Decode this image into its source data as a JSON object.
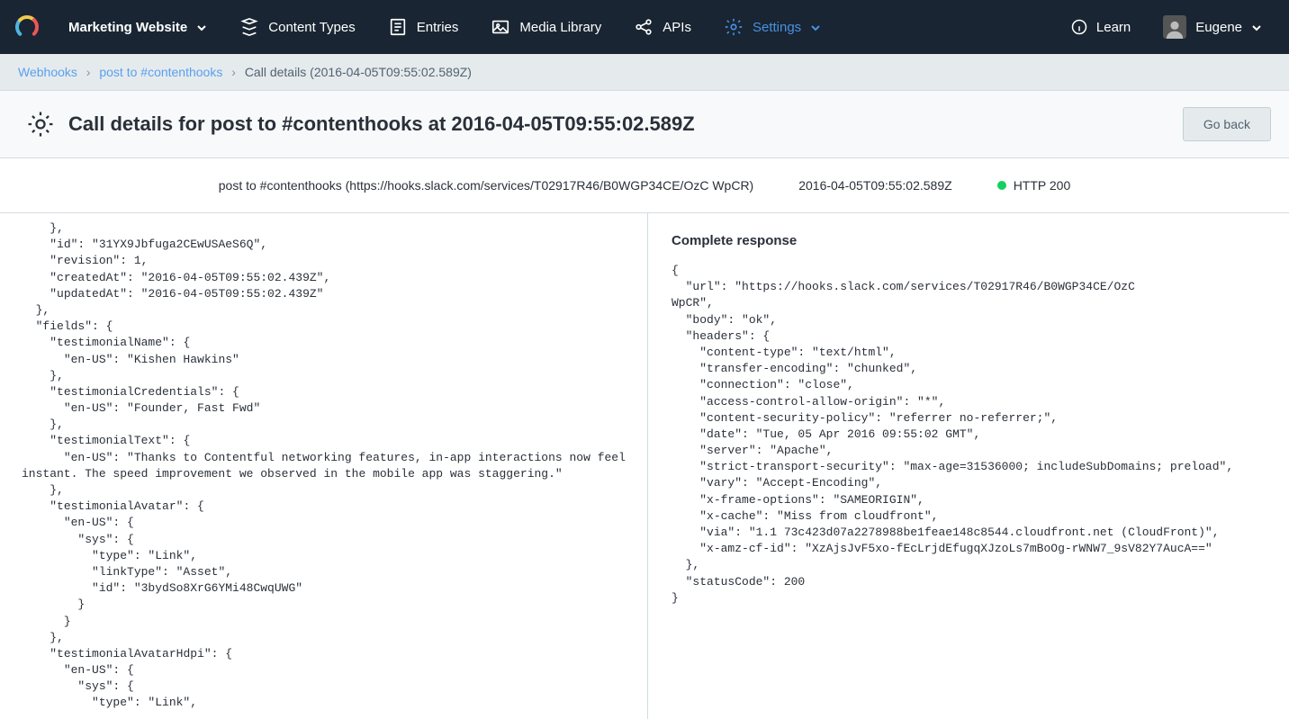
{
  "nav": {
    "space": "Marketing Website",
    "items": {
      "contentTypes": "Content Types",
      "entries": "Entries",
      "mediaLibrary": "Media Library",
      "apis": "APIs",
      "settings": "Settings"
    },
    "learn": "Learn",
    "user": "Eugene"
  },
  "breadcrumb": {
    "a": "Webhooks",
    "b": "post to #contenthooks",
    "current": "Call details (2016-04-05T09:55:02.589Z)"
  },
  "title": "Call details for post to #contenthooks at 2016-04-05T09:55:02.589Z",
  "goBack": "Go back",
  "summary": {
    "endpoint": "post to #contenthooks (https://hooks.slack.com/services/T02917R46/B0WGP34CE/OzC                                       WpCR)",
    "timestamp": "2016-04-05T09:55:02.589Z",
    "status": "HTTP 200"
  },
  "response": {
    "heading": "Complete response",
    "body": "{\n  \"url\": \"https://hooks.slack.com/services/T02917R46/B0WGP34CE/OzC                   WpCR\",\n  \"body\": \"ok\",\n  \"headers\": {\n    \"content-type\": \"text/html\",\n    \"transfer-encoding\": \"chunked\",\n    \"connection\": \"close\",\n    \"access-control-allow-origin\": \"*\",\n    \"content-security-policy\": \"referrer no-referrer;\",\n    \"date\": \"Tue, 05 Apr 2016 09:55:02 GMT\",\n    \"server\": \"Apache\",\n    \"strict-transport-security\": \"max-age=31536000; includeSubDomains; preload\",\n    \"vary\": \"Accept-Encoding\",\n    \"x-frame-options\": \"SAMEORIGIN\",\n    \"x-cache\": \"Miss from cloudfront\",\n    \"via\": \"1.1 73c423d07a2278988be1feae148c8544.cloudfront.net (CloudFront)\",\n    \"x-amz-cf-id\": \"XzAjsJvF5xo-fEcLrjdEfugqXJzoLs7mBoOg-rWNW7_9sV82Y7AucA==\"\n  },\n  \"statusCode\": 200\n}"
  },
  "request": {
    "body": "    },\n    \"id\": \"31YX9Jbfuga2CEwUSAeS6Q\",\n    \"revision\": 1,\n    \"createdAt\": \"2016-04-05T09:55:02.439Z\",\n    \"updatedAt\": \"2016-04-05T09:55:02.439Z\"\n  },\n  \"fields\": {\n    \"testimonialName\": {\n      \"en-US\": \"Kishen Hawkins\"\n    },\n    \"testimonialCredentials\": {\n      \"en-US\": \"Founder, Fast Fwd\"\n    },\n    \"testimonialText\": {\n      \"en-US\": \"Thanks to Contentful networking features, in-app interactions now feel instant. The speed improvement we observed in the mobile app was staggering.\"\n    },\n    \"testimonialAvatar\": {\n      \"en-US\": {\n        \"sys\": {\n          \"type\": \"Link\",\n          \"linkType\": \"Asset\",\n          \"id\": \"3bydSo8XrG6YMi48CwqUWG\"\n        }\n      }\n    },\n    \"testimonialAvatarHdpi\": {\n      \"en-US\": {\n        \"sys\": {\n          \"type\": \"Link\","
  }
}
